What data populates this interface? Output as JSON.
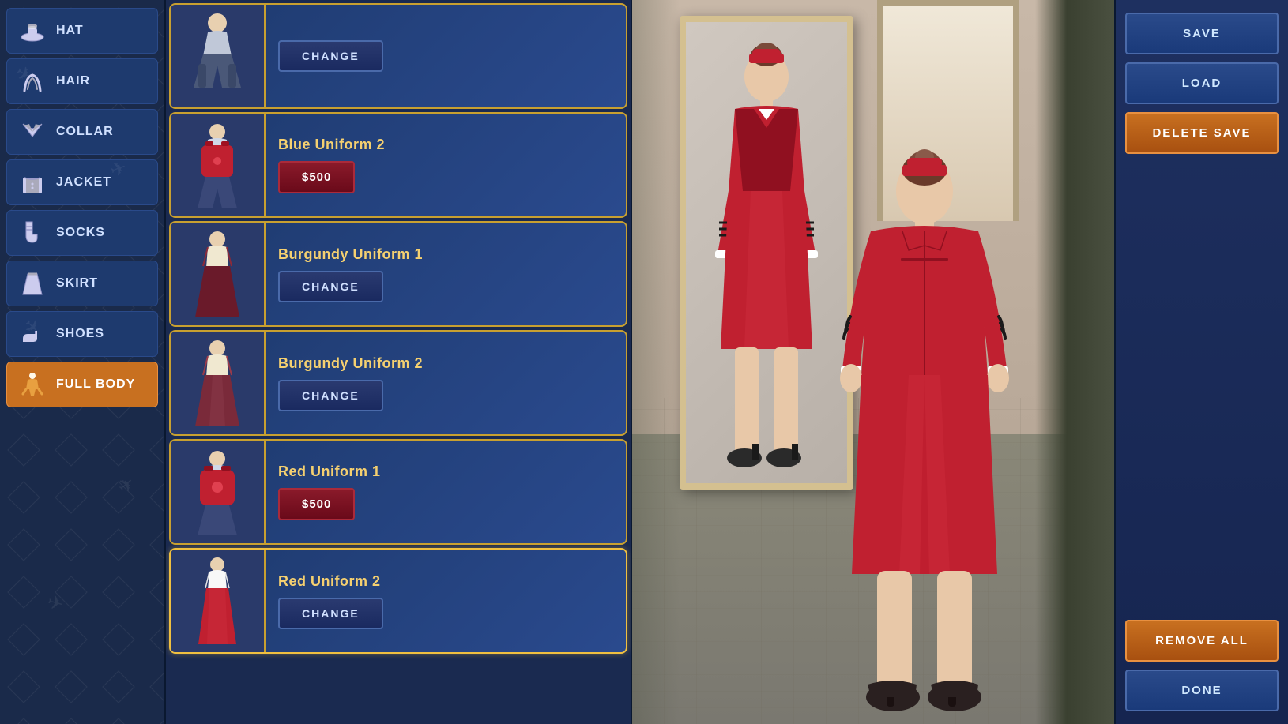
{
  "sidebar": {
    "items": [
      {
        "id": "hat",
        "label": "Hat",
        "icon": "🎩"
      },
      {
        "id": "hair",
        "label": "Hair",
        "icon": "〰"
      },
      {
        "id": "collar",
        "label": "Collar",
        "icon": "👔"
      },
      {
        "id": "jacket",
        "label": "Jacket",
        "icon": "🧥"
      },
      {
        "id": "socks",
        "label": "Socks",
        "icon": "🧦"
      },
      {
        "id": "skirt",
        "label": "Skirt",
        "icon": "👗"
      },
      {
        "id": "shoes",
        "label": "Shoes",
        "icon": "👠"
      },
      {
        "id": "full-body",
        "label": "Full Body",
        "icon": "🧍",
        "active": true
      }
    ]
  },
  "items_panel": {
    "outfits": [
      {
        "id": "outfit-0",
        "name": "",
        "button_type": "change",
        "button_label": "CHANGE",
        "selected": false
      },
      {
        "id": "outfit-blue-2",
        "name": "Blue Uniform 2",
        "button_type": "price",
        "button_label": "$500",
        "selected": false
      },
      {
        "id": "outfit-burgundy-1",
        "name": "Burgundy Uniform 1",
        "button_type": "change",
        "button_label": "CHANGE",
        "selected": false
      },
      {
        "id": "outfit-burgundy-2",
        "name": "Burgundy Uniform 2",
        "button_type": "change",
        "button_label": "CHANGE",
        "selected": false
      },
      {
        "id": "outfit-red-1",
        "name": "Red Uniform 1",
        "button_type": "price",
        "button_label": "$500",
        "selected": false
      },
      {
        "id": "outfit-red-2",
        "name": "Red Uniform 2",
        "button_type": "change",
        "button_label": "CHANGE",
        "selected": true
      }
    ]
  },
  "right_panel": {
    "save_label": "SAVE",
    "load_label": "LOAD",
    "delete_save_label": "DELETE SAVE",
    "remove_all_label": "REMOVE ALL",
    "done_label": "DONE"
  }
}
